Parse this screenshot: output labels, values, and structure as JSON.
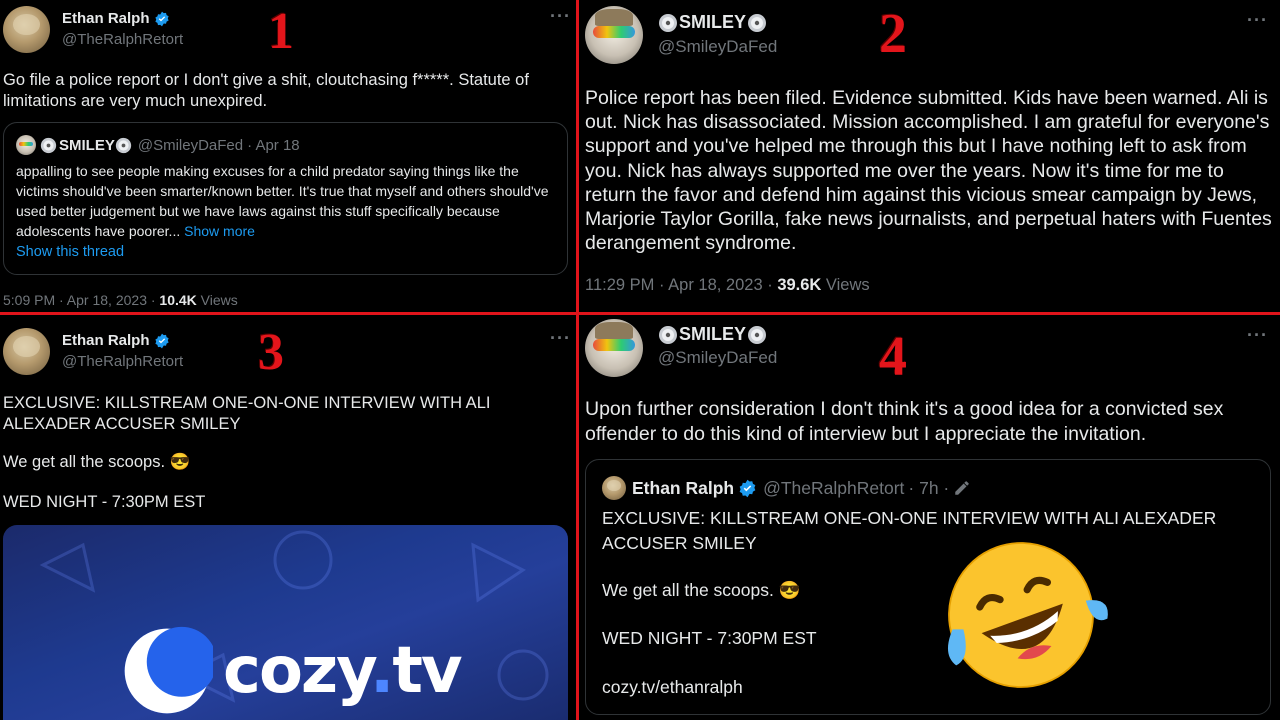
{
  "panels": [
    {
      "number": "1",
      "author_name": "Ethan Ralph",
      "author_handle": "@TheRalphRetort",
      "tweet_text": "Go file a police report or I don't give a shit, cloutchasing f*****. Statute of limitations are very much unexpired.",
      "quote": {
        "author_name": "SMILEY",
        "author_handle": "@SmileyDaFed",
        "date": "· Apr 18",
        "text": "appalling to see people making excuses for a child predator saying things like the victims should've been smarter/known better. It's true that myself and others should've used better judgement but we have laws against this stuff specifically because adolescents have poorer...",
        "show_more": "Show more",
        "show_thread": "Show this thread"
      },
      "timestamp": "5:09 PM · Apr 18, 2023 · ",
      "views_count": "10.4K",
      "views_label": " Views"
    },
    {
      "number": "2",
      "author_name": "SMILEY",
      "author_handle": "@SmileyDaFed",
      "tweet_text": "Police report has been filed. Evidence submitted. Kids have been warned. Ali is out. Nick has disassociated. Mission accomplished. I am grateful for everyone's support and you've helped me through this but I have nothing left to ask from you. Nick has always supported me over the years. Now it's time for me to return the favor and defend him against this vicious smear campaign by Jews, Marjorie Taylor Gorilla, fake news journalists, and perpetual haters with Fuentes derangement syndrome.",
      "timestamp": "11:29 PM · Apr 18, 2023 · ",
      "views_count": "39.6K",
      "views_label": " Views"
    },
    {
      "number": "3",
      "author_name": "Ethan Ralph",
      "author_handle": "@TheRalphRetort",
      "tweet_line1": "EXCLUSIVE: KILLSTREAM ONE-ON-ONE INTERVIEW WITH ALI ALEXADER ACCUSER SMILEY",
      "tweet_line2": "We get all the scoops. 😎",
      "tweet_line3": "WED NIGHT - 7:30PM EST",
      "card_brand": "cozy",
      "card_brand_dot": ".",
      "card_brand_tld": "tv"
    },
    {
      "number": "4",
      "author_name": "SMILEY",
      "author_handle": "@SmileyDaFed",
      "tweet_text": "Upon further consideration I don't think it's a good idea for a convicted sex offender to do this kind of interview but I appreciate the invitation.",
      "quote": {
        "author_name": "Ethan Ralph",
        "author_handle": "@TheRalphRetort",
        "age": "· 7h ·",
        "line1": "EXCLUSIVE: KILLSTREAM ONE-ON-ONE INTERVIEW WITH ALI ALEXADER ACCUSER SMILEY",
        "line2": "We get all the scoops. 😎",
        "line3": "WED NIGHT - 7:30PM EST",
        "line4": "cozy.tv/ethanralph"
      },
      "reaction_emoji": "🤣"
    }
  ],
  "colors": {
    "divider": "#e0141b",
    "number": "#e3151b",
    "link": "#1d9bf0",
    "verified": "#1d9bf0"
  },
  "icons": [
    "verified-badge-icon",
    "more-options-icon",
    "disc-icon",
    "edit-icon",
    "cozy-moon-icon"
  ]
}
